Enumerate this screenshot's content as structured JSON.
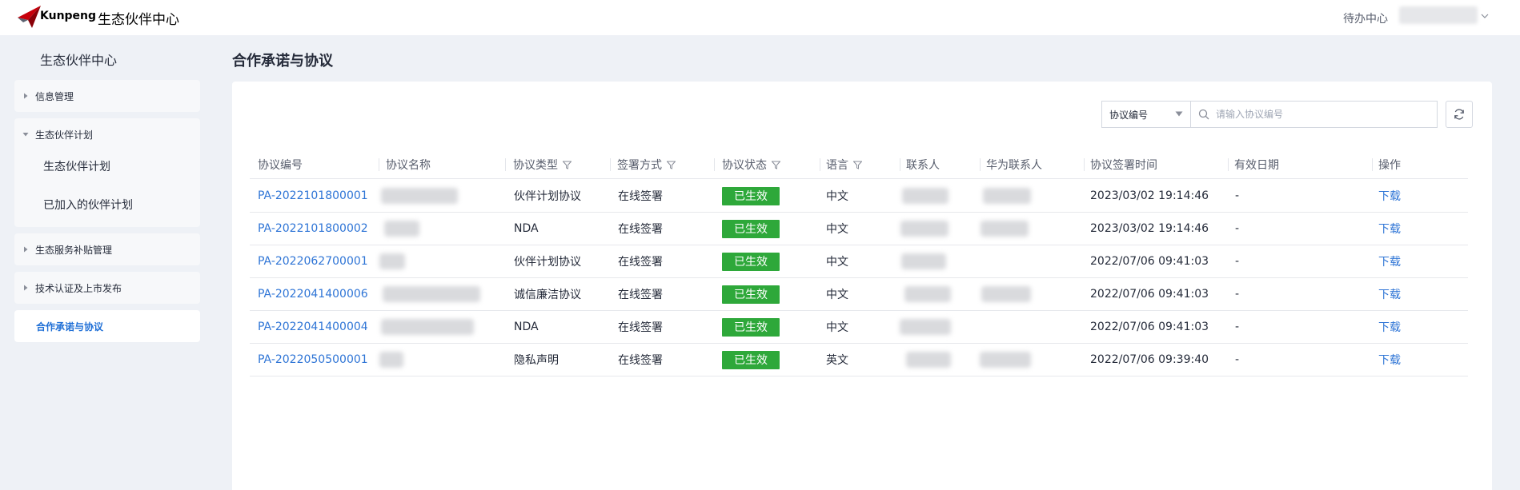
{
  "header": {
    "brand": "Kunpeng",
    "site_title": "生态伙伴中心",
    "todo_center": "待办中心"
  },
  "sidebar": {
    "title": "生态伙伴中心",
    "items": [
      {
        "label": "信息管理",
        "expanded": false
      },
      {
        "label": "生态伙伴计划",
        "expanded": true,
        "children": [
          {
            "label": "生态伙伴计划"
          },
          {
            "label": "已加入的伙伴计划"
          }
        ]
      },
      {
        "label": "生态服务补贴管理",
        "expanded": false
      },
      {
        "label": "技术认证及上市发布",
        "expanded": false
      },
      {
        "label": "合作承诺与协议",
        "active": true
      }
    ]
  },
  "main": {
    "page_title": "合作承诺与协议",
    "search": {
      "select_value": "协议编号",
      "placeholder": "请输入协议编号"
    },
    "table": {
      "columns": [
        {
          "label": "协议编号",
          "filter": false
        },
        {
          "label": "协议名称",
          "filter": false
        },
        {
          "label": "协议类型",
          "filter": true
        },
        {
          "label": "签署方式",
          "filter": true
        },
        {
          "label": "协议状态",
          "filter": true
        },
        {
          "label": "语言",
          "filter": true
        },
        {
          "label": "联系人",
          "filter": false
        },
        {
          "label": "华为联系人",
          "filter": false
        },
        {
          "label": "协议签署时间",
          "filter": false
        },
        {
          "label": "有效日期",
          "filter": false
        },
        {
          "label": "操作",
          "filter": false
        }
      ],
      "rows": [
        {
          "id": "PA-2022101800001",
          "type": "伙伴计划协议",
          "sign": "在线签署",
          "status": "已生效",
          "lang": "中文",
          "time": "2023/03/02 19:14:46",
          "valid": "-",
          "action": "下载"
        },
        {
          "id": "PA-2022101800002",
          "type": "NDA",
          "sign": "在线签署",
          "status": "已生效",
          "lang": "中文",
          "time": "2023/03/02 19:14:46",
          "valid": "-",
          "action": "下载"
        },
        {
          "id": "PA-2022062700001",
          "type": "伙伴计划协议",
          "sign": "在线签署",
          "status": "已生效",
          "lang": "中文",
          "time": "2022/07/06 09:41:03",
          "valid": "-",
          "action": "下载"
        },
        {
          "id": "PA-2022041400006",
          "type": "诚信廉洁协议",
          "sign": "在线签署",
          "status": "已生效",
          "lang": "中文",
          "time": "2022/07/06 09:41:03",
          "valid": "-",
          "action": "下载"
        },
        {
          "id": "PA-2022041400004",
          "type": "NDA",
          "sign": "在线签署",
          "status": "已生效",
          "lang": "中文",
          "time": "2022/07/06 09:41:03",
          "valid": "-",
          "action": "下载"
        },
        {
          "id": "PA-2022050500001",
          "type": "隐私声明",
          "sign": "在线签署",
          "status": "已生效",
          "lang": "英文",
          "time": "2022/07/06 09:39:40",
          "valid": "-",
          "action": "下载"
        }
      ]
    }
  },
  "colors": {
    "accent": "#1f6fd6",
    "link": "#2f75d6",
    "status_active": "#2ea83a",
    "background": "#eef1f6",
    "logo_red": "#c7000b"
  },
  "icons": {
    "logo": "kunpeng-logo",
    "chevron": "chevron-down-icon",
    "tree_collapsed": "triangle-right-icon",
    "tree_expanded": "triangle-down-icon",
    "search": "search-icon",
    "refresh": "refresh-icon",
    "filter": "filter-icon",
    "select_arrow": "caret-down-icon"
  }
}
